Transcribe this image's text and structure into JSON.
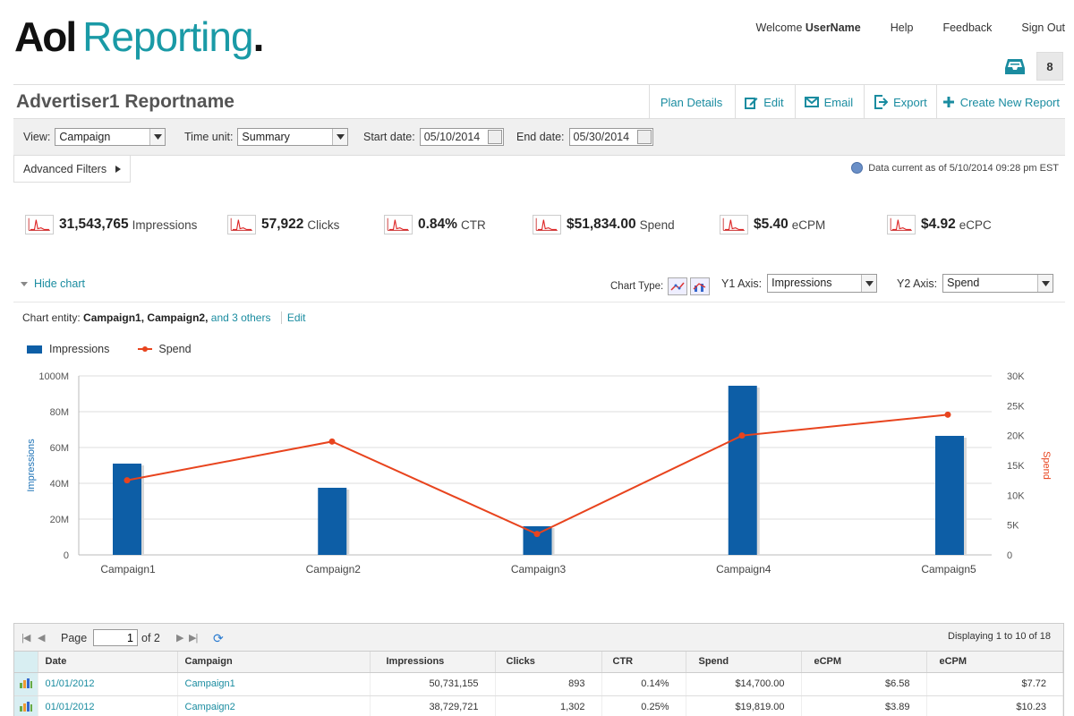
{
  "header": {
    "logo_aol": "Aol",
    "logo_reporting": "Reporting",
    "logo_dot": ".",
    "welcome": "Welcome",
    "username": "UserName",
    "help": "Help",
    "feedback": "Feedback",
    "signout": "Sign Out",
    "inbox_count": "8"
  },
  "report": {
    "title": "Advertiser1 Reportname",
    "actions": {
      "plan_details": "Plan Details",
      "edit": "Edit",
      "email": "Email",
      "export": "Export",
      "create": "Create New Report"
    }
  },
  "filters": {
    "view_label": "View:",
    "view_value": "Campaign",
    "timeunit_label": "Time unit:",
    "timeunit_value": "Summary",
    "start_label": "Start date:",
    "start_value": "05/10/2014",
    "end_label": "End date:",
    "end_value": "05/30/2014",
    "advanced": "Advanced Filters",
    "data_current": "Data current as of 5/10/2014 09:28 pm EST"
  },
  "metrics": [
    {
      "value": "31,543,765",
      "label": "Impressions"
    },
    {
      "value": "57,922",
      "label": "Clicks"
    },
    {
      "value": "0.84%",
      "label": "CTR"
    },
    {
      "value": "$51,834.00",
      "label": "Spend"
    },
    {
      "value": "$5.40",
      "label": "eCPM"
    },
    {
      "value": "$4.92",
      "label": "eCPC"
    }
  ],
  "chart_controls": {
    "hide_chart": "Hide chart",
    "chart_type_label": "Chart Type:",
    "y1_label": "Y1 Axis:",
    "y1_value": "Impressions",
    "y2_label": "Y2 Axis:",
    "y2_value": "Spend",
    "entity_label": "Chart entity:",
    "entity_list": "Campaign1, Campaign2,",
    "entity_more": "and 3 others",
    "entity_edit": "Edit"
  },
  "colors": {
    "bar": "#0d5ea6",
    "line": "#e8441e",
    "accent": "#1a8ca0"
  },
  "chart_data": {
    "type": "bar",
    "categories": [
      "Campaign1",
      "Campaign2",
      "Campaign3",
      "Campaign4",
      "Campaign5"
    ],
    "series": [
      {
        "name": "Impressions",
        "type": "bar",
        "axis": "y1",
        "values": [
          51000000,
          37500000,
          16000000,
          94500000,
          66500000
        ]
      },
      {
        "name": "Spend",
        "type": "line",
        "axis": "y2",
        "values": [
          12500,
          19000,
          3500,
          20000,
          23500
        ]
      }
    ],
    "ylabel": "Impressions",
    "y2label": "Spend",
    "ylim": [
      0,
      100000000
    ],
    "y2lim": [
      0,
      30000
    ],
    "yticks": [
      "0",
      "20M",
      "40M",
      "60M",
      "80M",
      "1000M"
    ],
    "y2ticks": [
      "0",
      "5K",
      "10K",
      "15K",
      "20K",
      "25K",
      "30K"
    ],
    "legend": "top-left",
    "grid": true
  },
  "table": {
    "pager": {
      "page_label": "Page",
      "page_value": "1",
      "of_label": "of 2",
      "displaying": "Displaying 1 to 10 of 18"
    },
    "columns": [
      "Date",
      "Campaign",
      "Impressions",
      "Clicks",
      "CTR",
      "Spend",
      "eCPM",
      "eCPM"
    ],
    "rows": [
      [
        "01/01/2012",
        "Campaign1",
        "50,731,155",
        "893",
        "0.14%",
        "$14,700.00",
        "$6.58",
        "$7.72"
      ],
      [
        "01/01/2012",
        "Campaign2",
        "38,729,721",
        "1,302",
        "0.25%",
        "$19,819.00",
        "$3.89",
        "$10.23"
      ]
    ]
  }
}
